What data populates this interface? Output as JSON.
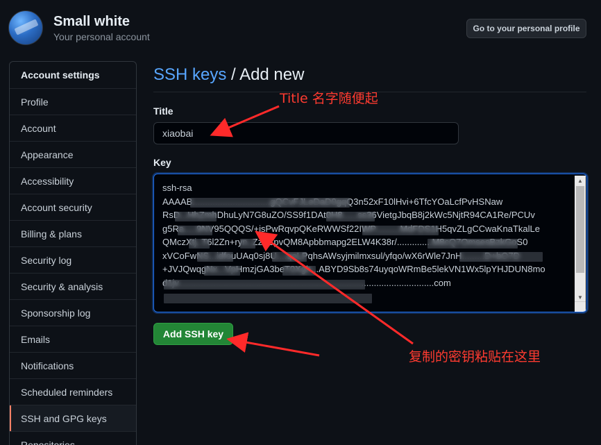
{
  "user": {
    "name": "Small white",
    "subtitle": "Your personal account",
    "profile_button": "Go to your personal profile"
  },
  "sidebar": {
    "items": [
      {
        "label": "Account settings",
        "header": true
      },
      {
        "label": "Profile"
      },
      {
        "label": "Account"
      },
      {
        "label": "Appearance"
      },
      {
        "label": "Accessibility"
      },
      {
        "label": "Account security"
      },
      {
        "label": "Billing & plans"
      },
      {
        "label": "Security log"
      },
      {
        "label": "Security & analysis"
      },
      {
        "label": "Sponsorship log"
      },
      {
        "label": "Emails"
      },
      {
        "label": "Notifications"
      },
      {
        "label": "Scheduled reminders"
      },
      {
        "label": "SSH and GPG keys",
        "selected": true
      },
      {
        "label": "Repositories"
      }
    ]
  },
  "main": {
    "breadcrumb": "SSH keys",
    "separator": "/",
    "title": "Add new",
    "title_label": "Title",
    "title_value": "xiaobai",
    "key_label": "Key",
    "key_value": "ssh-rsa\nAAAAB...............................gQCvFJLeDaD0gqQ3n52xF10lHvi+6TfcYOaLcfPvHSNaw\nRsD...HhZmhDhuLyN7G8uZO/SS9f1DAt0H8......ss36VietgJbqB8j2kWc5NjtR94CA1Re/PCUv\ng5Ra.....9NV95QQQS/+isPwRqvpQKeRWWSf22IWP..........MdFDS1H5qvZLgCCwaKnaTkalLe\nQMczXtj..T6l2Zn+ryn..Zz+BpvQM8Apbbmapg2ELW4K38r/..............M8cQ7OmsesBzkGoS0\nxVCoFwNS...idfouUAq0sj8U....qoLPqhsAWsyjmilmxsul/yfqo/wX6rWle7JnH.........D+bO7D\n+JVJQwqgNx...VpHmzjGA3beT0Xgh...ABYD9Sb8s74uyqoWRmBe5lekVN1Wx5lpYHJDUN8mo\nd1jv......................................................................................................com",
    "add_button": "Add SSH key"
  },
  "annotations": {
    "title_note": "Title 名字随便起",
    "key_note": "复制的密钥粘贴在这里"
  },
  "colors": {
    "accent_link": "#58a6ff",
    "button_green": "#238636",
    "annotation_red": "#ff3b30",
    "selected_marker": "#f78166"
  }
}
